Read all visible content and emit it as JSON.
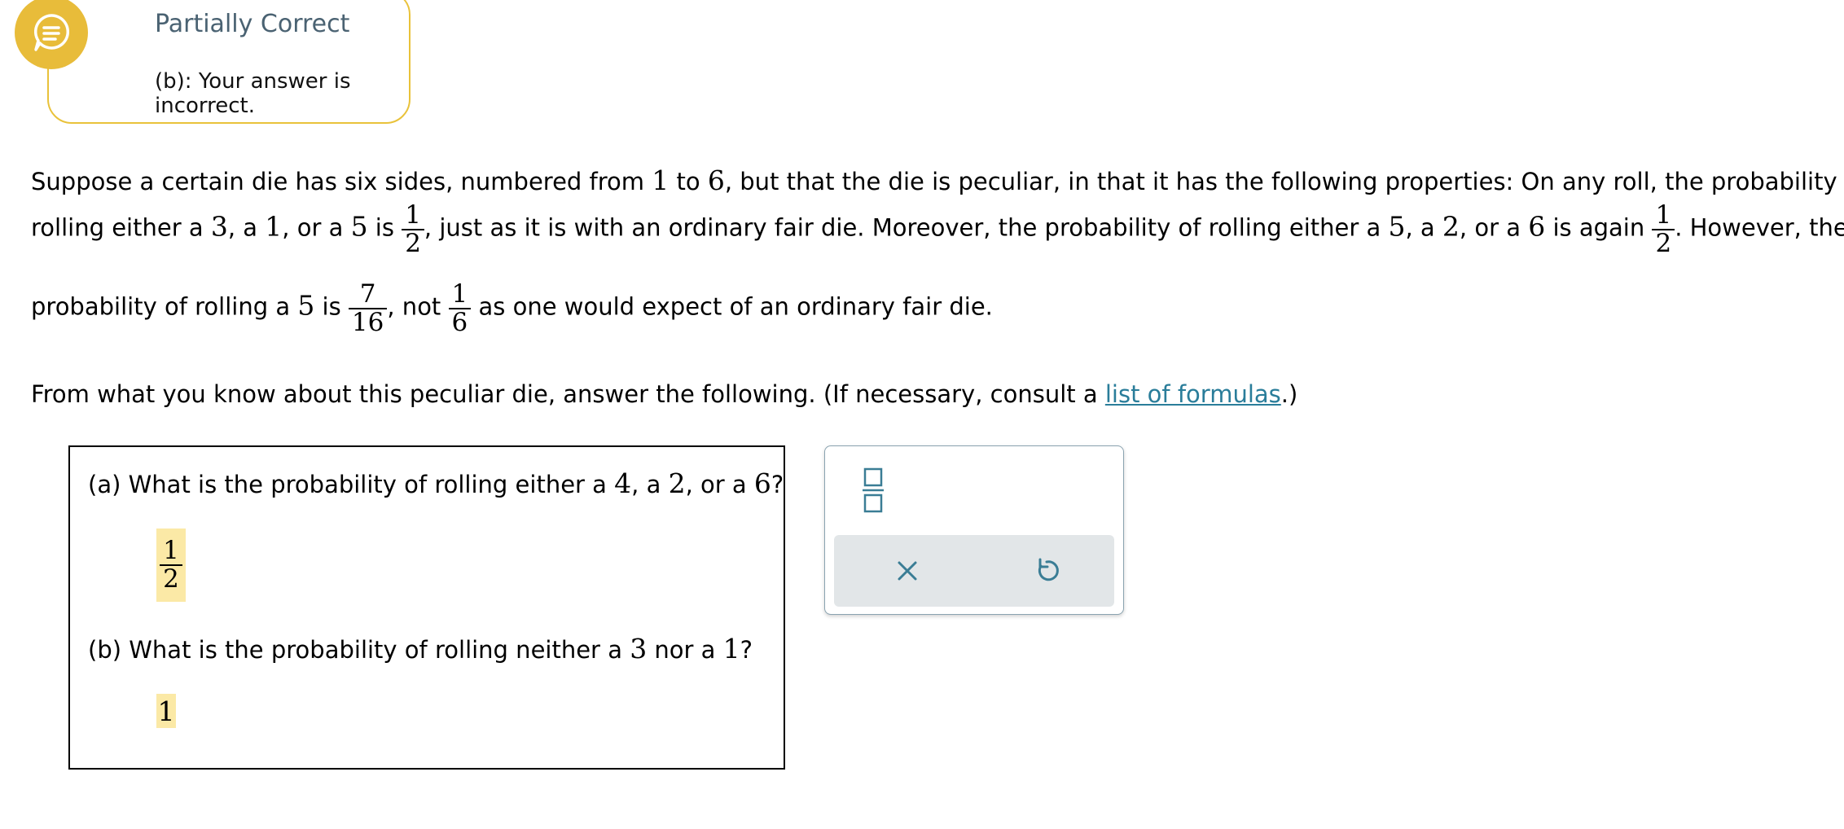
{
  "feedback": {
    "title": "Partially Correct",
    "message": "(b): Your answer is incorrect."
  },
  "problem": {
    "line1": {
      "t1": "Suppose a certain die has six sides, numbered from ",
      "n1": "1",
      "t2": " to ",
      "n2": "6",
      "t3": ", but that the die is peculiar, in that it has the following properties: On any roll, the probability of"
    },
    "line2": {
      "t1": "rolling either a ",
      "n1": "3",
      "t2": ", a ",
      "n2": "1",
      "t3": ", or a ",
      "n3": "5",
      "t4": " is ",
      "f1_num": "1",
      "f1_den": "2",
      "t5": ", just as it is with an ordinary fair die. Moreover, the probability of rolling either a ",
      "n4": "5",
      "t6": ", a ",
      "n5": "2",
      "t7": ", or a ",
      "n6": "6",
      "t8": " is again ",
      "f2_num": "1",
      "f2_den": "2",
      "t9": ". However, the"
    },
    "line3": {
      "t1": "probability of rolling a ",
      "n1": "5",
      "t2": " is ",
      "f1_num": "7",
      "f1_den": "16",
      "t3": ", not ",
      "f2_num": "1",
      "f2_den": "6",
      "t4": " as one would expect of an ordinary fair die."
    },
    "instruction": {
      "t1": "From what you know about this peculiar die, answer the following. (If necessary, consult a ",
      "link": "list of formulas",
      "t2": ".)"
    }
  },
  "questions": {
    "a": {
      "t1": "(a) What is the probability of rolling either a ",
      "n1": "4",
      "t2": ", a ",
      "n2": "2",
      "t3": ", or a ",
      "n3": "6",
      "t4": "?",
      "answer_num": "1",
      "answer_den": "2"
    },
    "b": {
      "t1": "(b) What is the probability of rolling neither a ",
      "n1": "3",
      "t2": " nor a ",
      "n2": "1",
      "t3": "?",
      "answer": "1"
    }
  },
  "toolbar": {
    "icons": [
      "fraction-icon",
      "close-icon",
      "undo-icon"
    ]
  },
  "colors": {
    "feedback_accent": "#e8bc3a",
    "feedback_title": "#4a6272",
    "answer_highlight": "#fbe9a6",
    "link": "#2a7d9a",
    "tool_icon": "#3a7d95",
    "tool_bar_bg": "#e2e6e8"
  }
}
